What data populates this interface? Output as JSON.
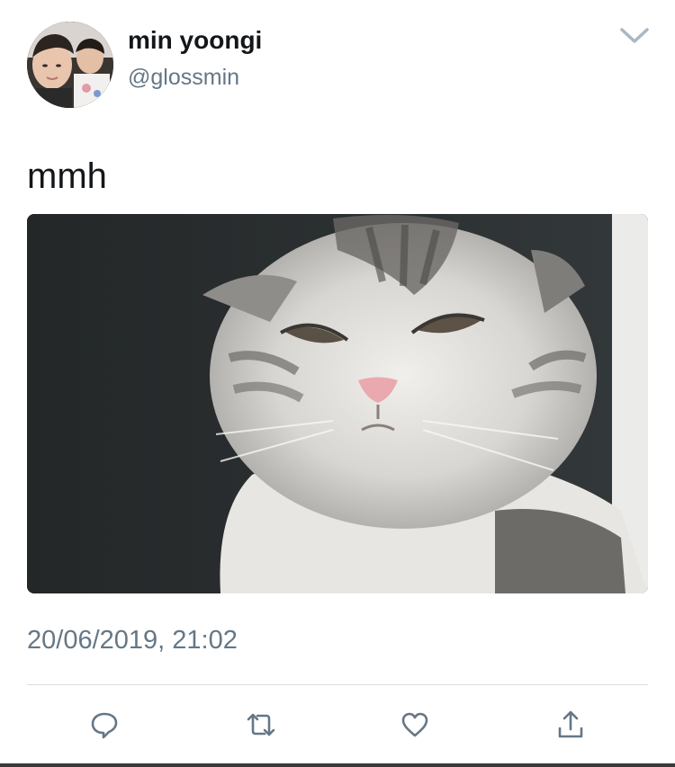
{
  "tweet": {
    "author": {
      "display_name": "min yoongi",
      "handle": "@glossmin"
    },
    "text": "mmh",
    "timestamp": "20/06/2019, 21:02",
    "media": {
      "kind": "photo"
    }
  },
  "icons": {
    "menu": "chevron-down-icon",
    "reply": "reply-icon",
    "retweet": "retweet-icon",
    "like": "heart-icon",
    "share": "share-icon"
  },
  "colors": {
    "text": "#14171a",
    "secondary": "#657786",
    "icon": "#657786",
    "divider": "#d9dee3"
  }
}
